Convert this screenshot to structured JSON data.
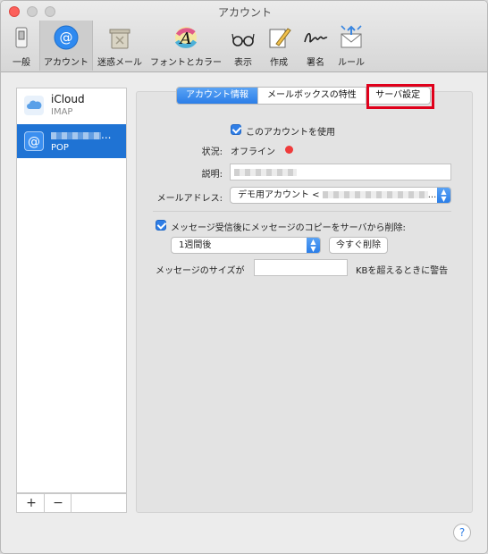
{
  "window": {
    "title": "アカウント"
  },
  "toolbar": {
    "items": [
      {
        "label": "一般"
      },
      {
        "label": "アカウント"
      },
      {
        "label": "迷惑メール"
      },
      {
        "label": "フォントとカラー"
      },
      {
        "label": "表示"
      },
      {
        "label": "作成"
      },
      {
        "label": "署名"
      },
      {
        "label": "ルール"
      }
    ],
    "active_index": 1
  },
  "accounts": {
    "items": [
      {
        "name": "iCloud",
        "type": "IMAP",
        "icon": "cloud-icon"
      },
      {
        "name": "...",
        "type": "POP",
        "icon": "at-icon",
        "selected": true
      }
    ],
    "add_label": "+",
    "remove_label": "−"
  },
  "tabs": {
    "items": [
      {
        "label": "アカウント情報",
        "active": true
      },
      {
        "label": "メールボックスの特性"
      },
      {
        "label": "サーバ設定"
      }
    ]
  },
  "account_info": {
    "enable_label": "このアカウントを使用",
    "enable_checked": true,
    "status_label": "状況:",
    "status_value": "オフライン",
    "status_color": "#ef3b3b",
    "description_label": "説明:",
    "email_label": "メールアドレス:",
    "email_value": "デモ用アカウント <",
    "email_suffix": "...",
    "remove_copy_label": "メッセージ受信後にメッセージのコピーをサーバから削除:",
    "remove_copy_checked": true,
    "remove_after_value": "1週間後",
    "remove_now_label": "今すぐ削除",
    "size_label": "メッセージのサイズが",
    "size_suffix": "KBを超えるときに警告",
    "size_value": ""
  },
  "help_label": "?",
  "colors": {
    "accent": "#2f7ee6",
    "highlight": "#e0001b",
    "selection": "#1f73d4"
  }
}
